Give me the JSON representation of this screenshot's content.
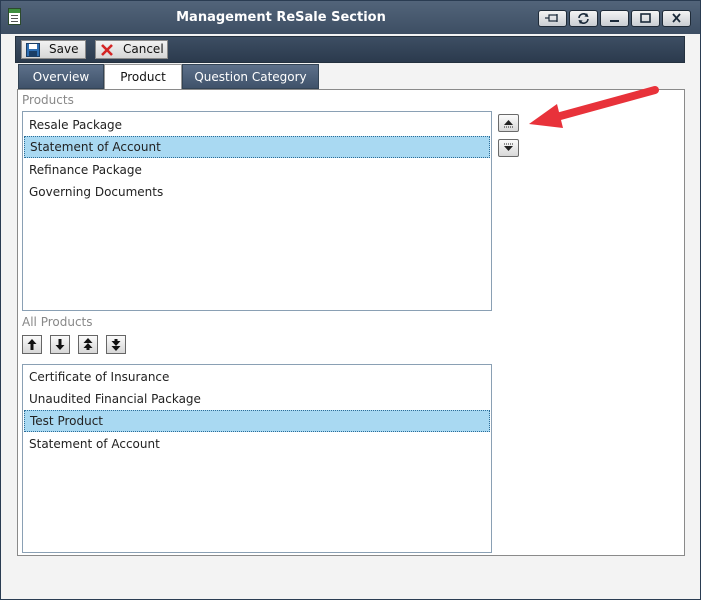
{
  "window": {
    "title": "Management ReSale Section",
    "icon": "document-icon",
    "controls": [
      "pin-icon",
      "restore-refresh-icon",
      "minimize-icon",
      "maximize-icon",
      "close-icon"
    ]
  },
  "toolbar": {
    "save_label": "Save",
    "cancel_label": "Cancel"
  },
  "tabs": [
    {
      "label": "Overview",
      "active": false
    },
    {
      "label": "Product",
      "active": true
    },
    {
      "label": "Question Category",
      "active": false
    }
  ],
  "products": {
    "label": "Products",
    "items": [
      {
        "text": "Resale Package",
        "selected": false
      },
      {
        "text": "Statement of Account",
        "selected": true
      },
      {
        "text": "Refinance Package",
        "selected": false
      },
      {
        "text": "Governing Documents",
        "selected": false
      }
    ]
  },
  "all_products": {
    "label": "All Products",
    "items": [
      {
        "text": "Certificate of Insurance",
        "selected": false
      },
      {
        "text": "Unaudited Financial Package",
        "selected": false
      },
      {
        "text": "Test Product",
        "selected": true
      },
      {
        "text": "Statement of Account",
        "selected": false
      }
    ]
  },
  "colors": {
    "titlebar": "#4a5c72",
    "selection": "#a9d9f2",
    "annotation_arrow": "#e8323a"
  }
}
